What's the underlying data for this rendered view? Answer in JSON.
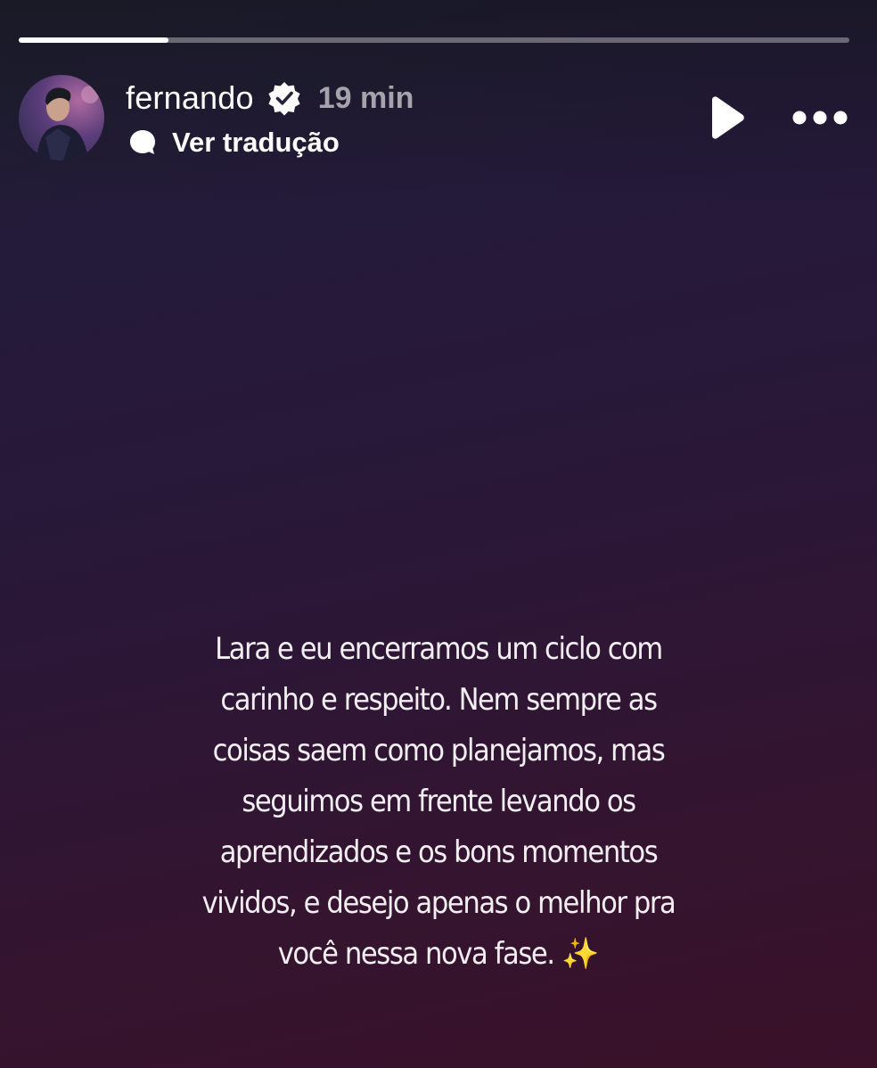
{
  "story": {
    "progress_fraction": 0.18,
    "background_colors": [
      "#1f2032",
      "#2a1738",
      "#3a1129"
    ]
  },
  "header": {
    "username": "fernando",
    "verified_icon": "verified-badge-icon",
    "time_ago": "19 min",
    "translate_icon": "speech-bubble-icon",
    "translate_label": "Ver tradução",
    "play_icon": "play-icon",
    "more_icon": "more-options-icon"
  },
  "caption": {
    "lines": [
      "Lara e eu encerramos um ciclo com",
      "carinho e respeito. Nem sempre as",
      "coisas saem como planejamos, mas",
      "seguimos em frente levando os",
      "aprendizados e os bons momentos",
      "vividos, e desejo apenas o melhor pra",
      "você nessa nova fase."
    ],
    "emoji": "✨"
  }
}
